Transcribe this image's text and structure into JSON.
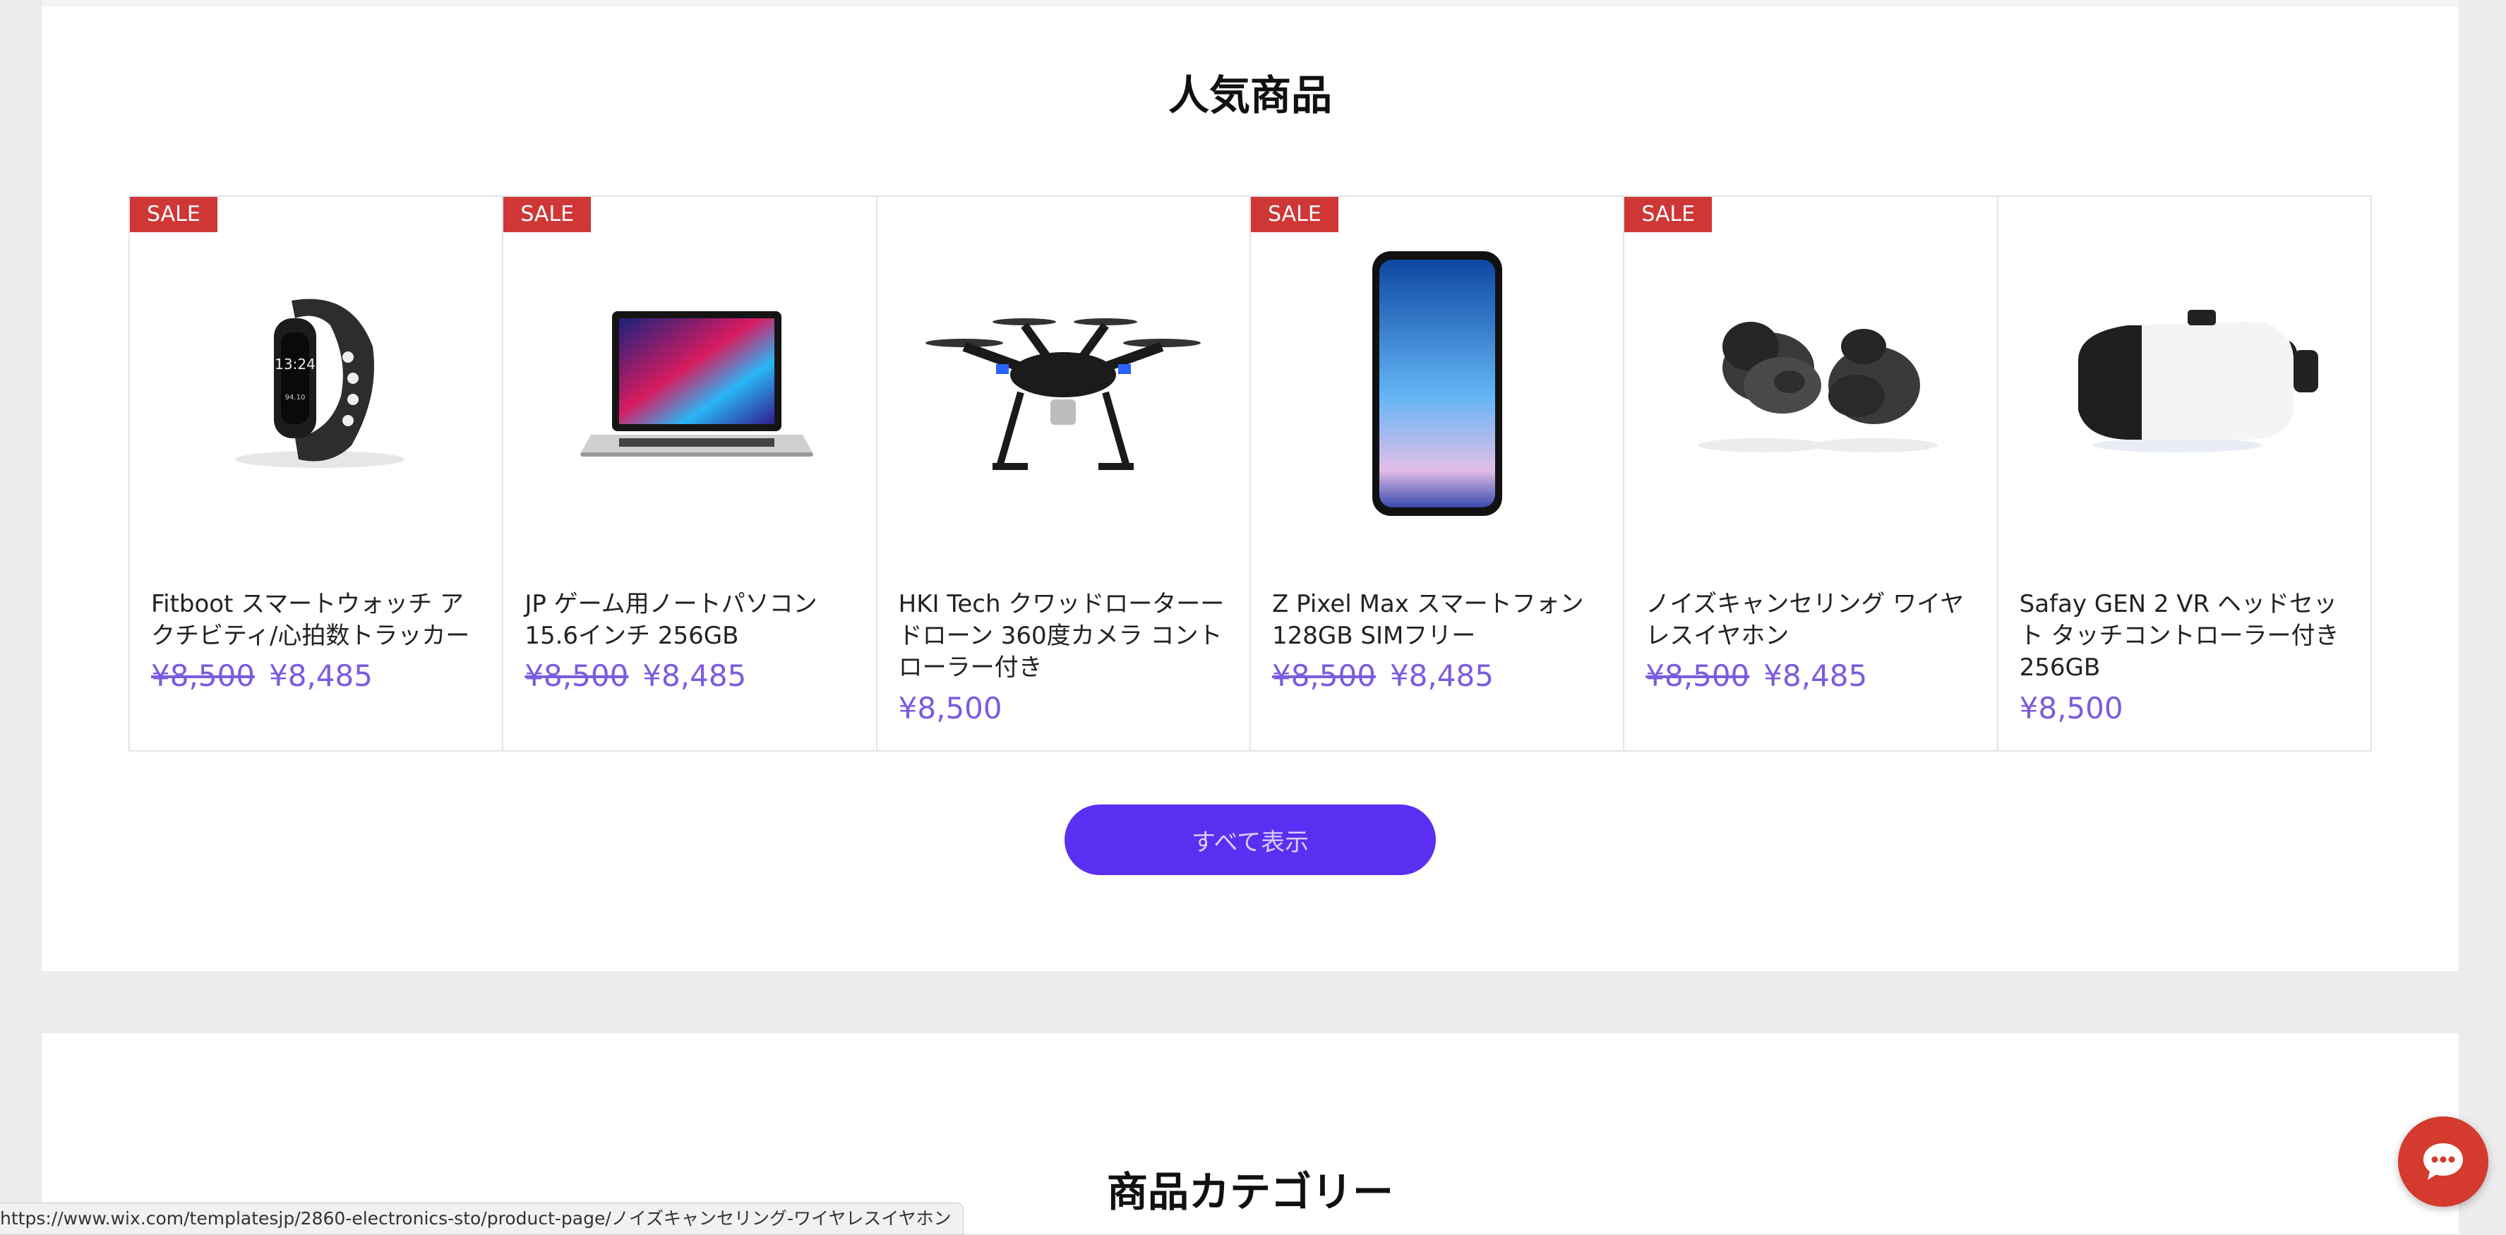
{
  "featured": {
    "title": "人気商品",
    "view_all_label": "すべて表示",
    "products": [
      {
        "name": "Fitboot スマートウォッチ アクチビティ/心拍数トラッカー",
        "sale": "SALE",
        "old_price": "¥8,500",
        "price": "¥8,485",
        "icon": "smartwatch-icon"
      },
      {
        "name": "JP ゲーム用ノートパソコン 15.6インチ 256GB",
        "sale": "SALE",
        "old_price": "¥8,500",
        "price": "¥8,485",
        "icon": "laptop-icon"
      },
      {
        "name": "HKI Tech クワッドローターードローン 360度カメラ コントローラー付き",
        "sale": "",
        "old_price": "",
        "price": "¥8,500",
        "icon": "drone-icon"
      },
      {
        "name": "Z Pixel Max スマートフォン 128GB SIMフリー",
        "sale": "SALE",
        "old_price": "¥8,500",
        "price": "¥8,485",
        "icon": "smartphone-icon"
      },
      {
        "name": "ノイズキャンセリング ワイヤレスイヤホン",
        "sale": "SALE",
        "old_price": "¥8,500",
        "price": "¥8,485",
        "icon": "earbuds-icon"
      },
      {
        "name": "Safay GEN 2 VR ヘッドセット タッチコントローラー付き 256GB",
        "sale": "",
        "old_price": "",
        "price": "¥8,500",
        "icon": "vr-headset-icon"
      }
    ]
  },
  "categories": {
    "title": "商品カテゴリー"
  },
  "status_bar": {
    "url": "https://www.wix.com/templatesjp/2860-electronics-sto/product-page/ノイズキャンセリング-ワイヤレスイヤホン"
  },
  "chat": {
    "icon": "chat-bubble-icon"
  },
  "colors": {
    "sale_ribbon": "#cf3636",
    "price": "#7b5be0",
    "button": "#5b2ff2",
    "chat": "#d53a2f"
  }
}
